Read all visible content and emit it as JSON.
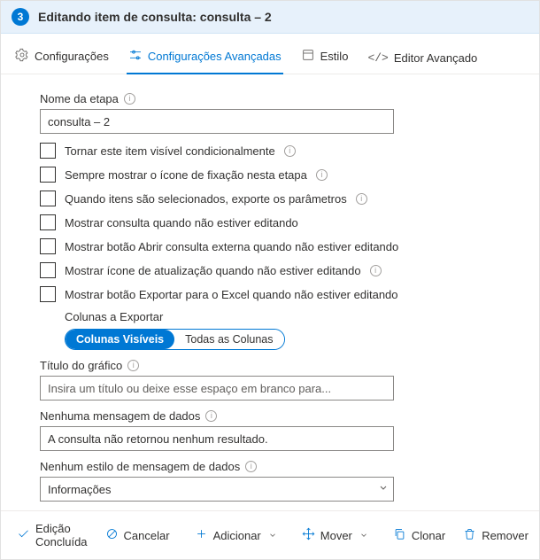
{
  "header": {
    "step": "3",
    "title": "Editando item de consulta: consulta – 2"
  },
  "tabs": {
    "settings": "Configurações",
    "advanced": "Configurações Avançadas",
    "style": "Estilo",
    "editor": "Editor Avançado"
  },
  "form": {
    "stepNameLabel": "Nome da etapa",
    "stepNameValue": "consulta – 2",
    "checks": {
      "c0": "Tornar este item visível condicionalmente",
      "c1": "Sempre mostrar o ícone de fixação nesta etapa",
      "c2": "Quando itens são selecionados, exporte os parâmetros",
      "c3": "Mostrar consulta quando não estiver editando",
      "c4": "Mostrar botão Abrir consulta externa quando não estiver editando",
      "c5": "Mostrar ícone de atualização quando não estiver editando",
      "c6": "Mostrar botão Exportar para o Excel quando não estiver editando"
    },
    "exportColsLabel": "Colunas a Exportar",
    "exportVisible": "Colunas Visíveis",
    "exportAll": "Todas as Colunas",
    "chartTitleLabel": "Título do gráfico",
    "chartTitlePlaceholder": "Insira um título ou deixe esse espaço em branco para...",
    "noDataMsgLabel": "Nenhuma mensagem de dados",
    "noDataMsgValue": "A consulta não retornou nenhum resultado.",
    "noDataStyleLabel": "Nenhum estilo de mensagem de dados",
    "noDataStyleValue": "Informações"
  },
  "footer": {
    "done": "Edição Concluída",
    "cancel": "Cancelar",
    "add": "Adicionar",
    "move": "Mover",
    "clone": "Clonar",
    "remove": "Remover"
  }
}
